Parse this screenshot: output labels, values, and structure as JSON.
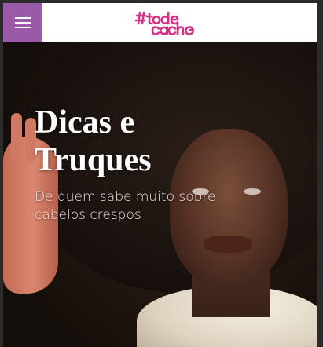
{
  "header": {
    "menu_icon": "hamburger-menu-icon",
    "logo_text": "#todecacho",
    "brand_color": "#d63384",
    "menu_color": "#9b5aa8"
  },
  "hero": {
    "title": "Dicas e Truques",
    "subtitle": "De quem sabe muito sobre cabelos crespos"
  }
}
